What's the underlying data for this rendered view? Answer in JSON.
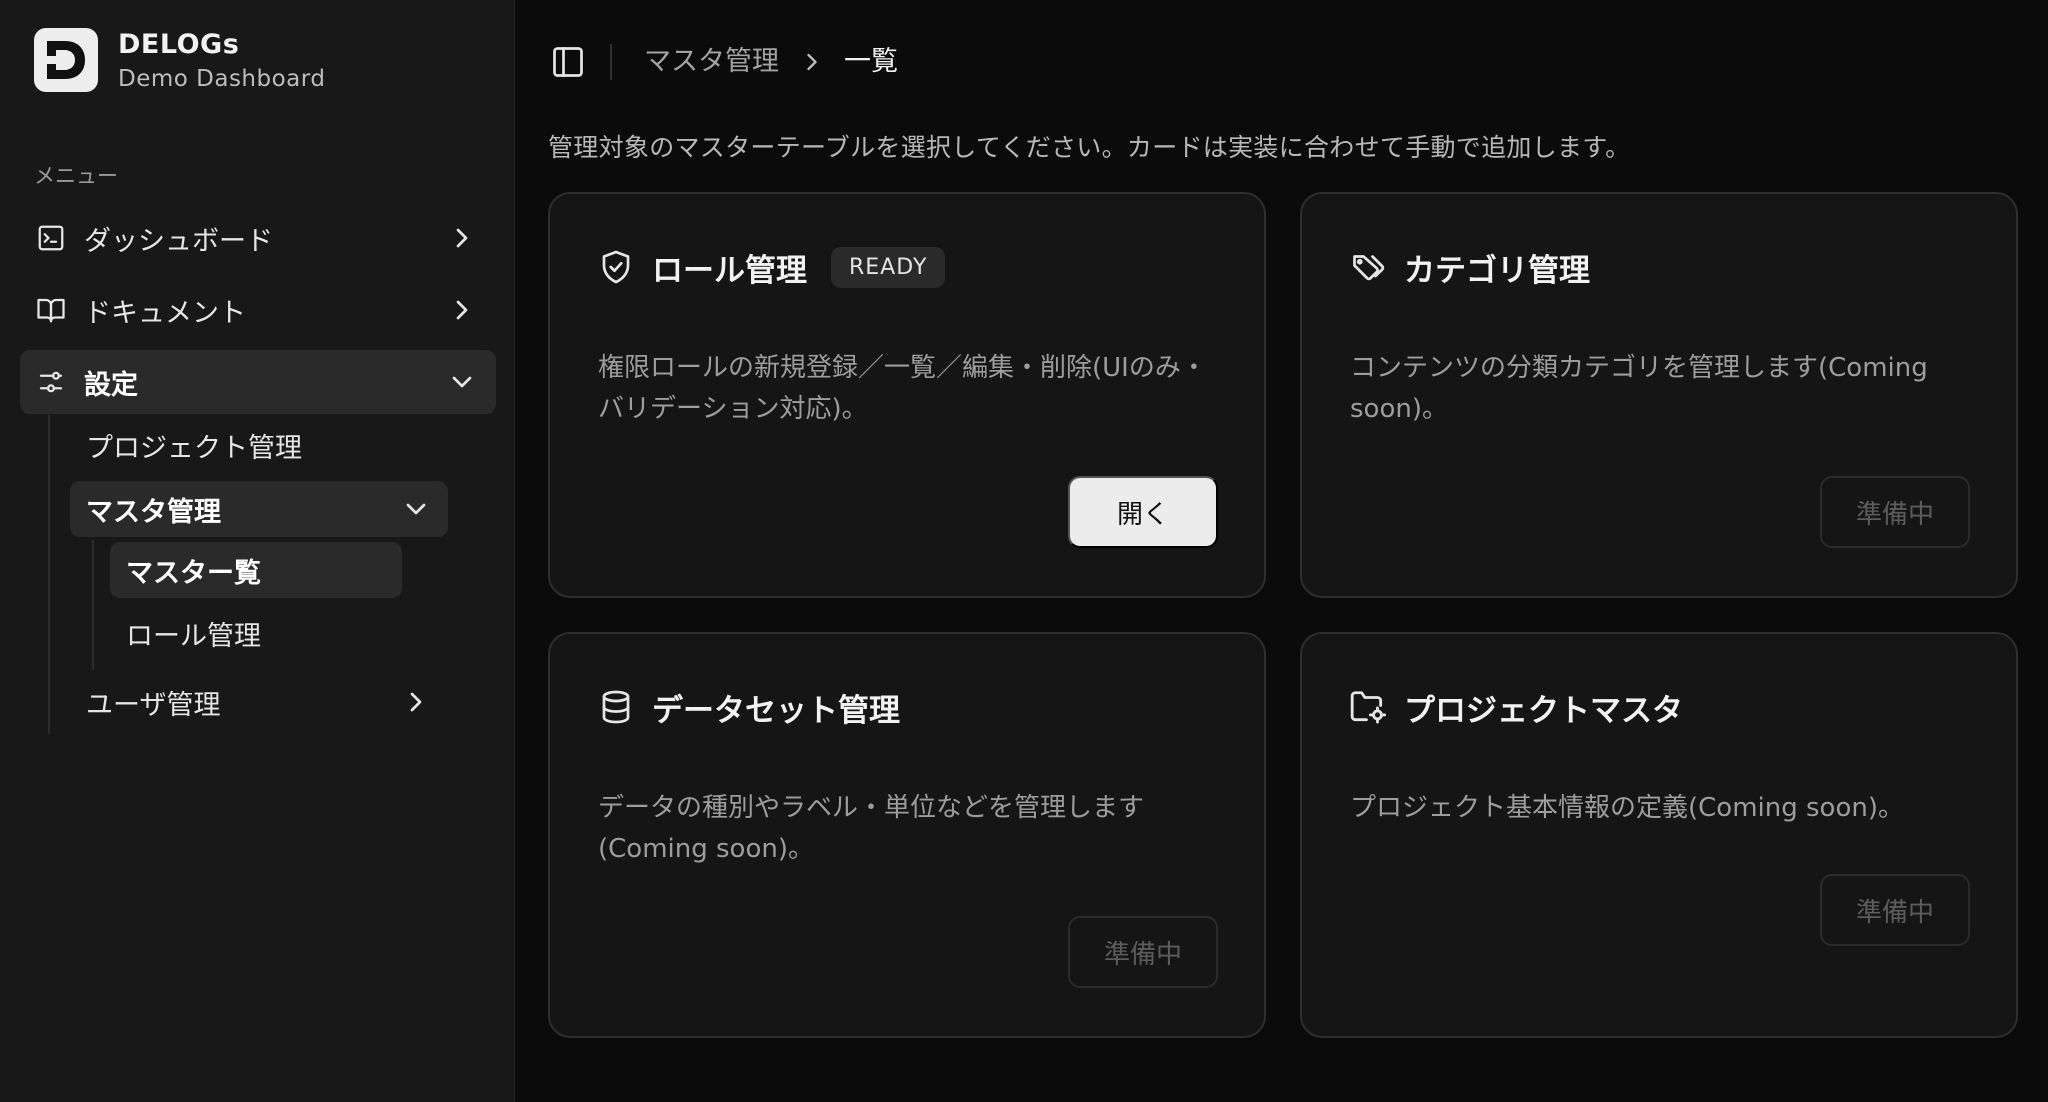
{
  "brand": {
    "name": "DELOGs",
    "subtitle": "Demo Dashboard"
  },
  "sidebar": {
    "menu_label": "メニュー",
    "items": [
      {
        "label": "ダッシュボード",
        "icon": "terminal-square-icon"
      },
      {
        "label": "ドキュメント",
        "icon": "book-open-icon"
      },
      {
        "label": "設定",
        "icon": "settings-sliders-icon",
        "expanded": true
      }
    ],
    "settings_children": {
      "project": "プロジェクト管理",
      "master": "マスタ管理",
      "master_children": [
        "マスター覧",
        "ロール管理"
      ],
      "users": "ユーザ管理"
    }
  },
  "header": {
    "breadcrumb": [
      "マスタ管理",
      "一覧"
    ]
  },
  "description": "管理対象のマスターテーブルを選択してください。カードは実装に合わせて手動で追加します。",
  "cards": [
    {
      "title": "ロール管理",
      "badge": "READY",
      "icon": "shield-check-icon",
      "desc": "権限ロールの新規登録／一覧／編集・削除(UIのみ・バリデーション対応)。",
      "button": "開く"
    },
    {
      "title": "カテゴリ管理",
      "icon": "tag-icon",
      "desc": "コンテンツの分類カテゴリを管理します(Coming soon)。",
      "button": "準備中"
    },
    {
      "title": "データセット管理",
      "icon": "database-icon",
      "desc": "データの種別やラベル・単位などを管理します(Coming soon)。",
      "button": "準備中"
    },
    {
      "title": "プロジェクトマスタ",
      "icon": "folder-cog-icon",
      "desc": "プロジェクト基本情報の定義(Coming soon)。",
      "button": "準備中"
    }
  ],
  "colors": {
    "background": "#0b0b0b",
    "sidebar": "#181818",
    "card": "#151515",
    "active": "#2a2a2a",
    "primary_button": "#ececec"
  }
}
